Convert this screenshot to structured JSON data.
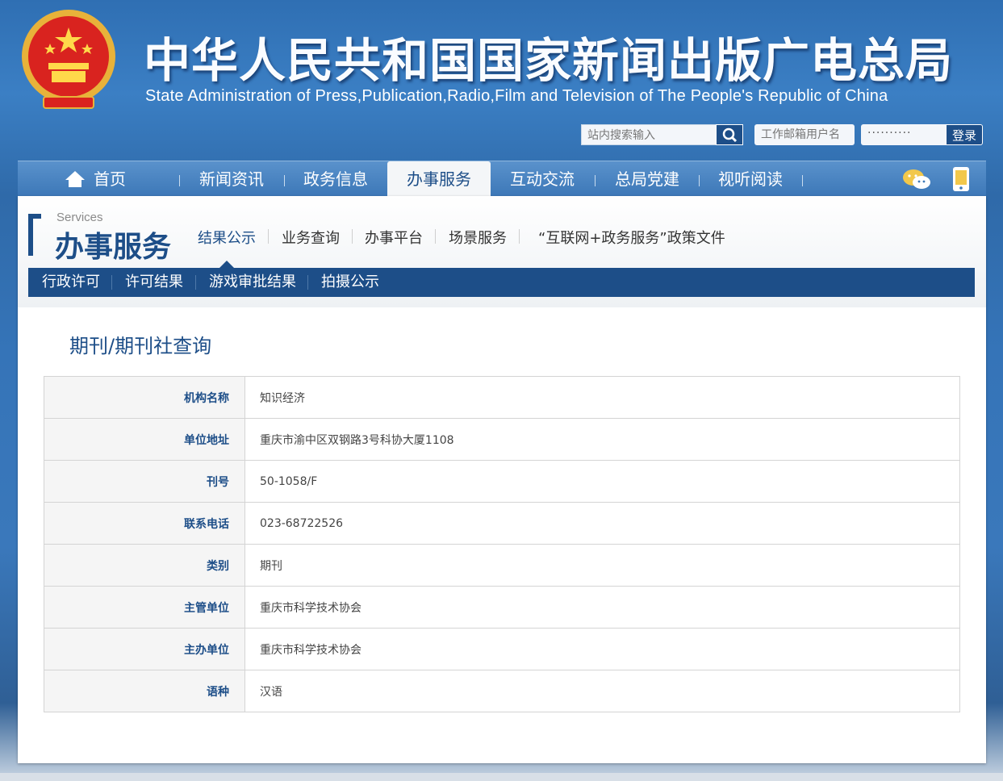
{
  "header": {
    "title_cn": "中华人民共和国国家新闻出版广电总局",
    "title_en": "State Administration of Press,Publication,Radio,Film and Television of The People's Republic of China",
    "search_placeholder": "站内搜索输入",
    "user_placeholder": "工作邮箱用户名",
    "password_mask": "··········",
    "login_label": "登录"
  },
  "nav": {
    "items": [
      {
        "label": "首页"
      },
      {
        "label": "新闻资讯"
      },
      {
        "label": "政务信息"
      },
      {
        "label": "办事服务"
      },
      {
        "label": "互动交流"
      },
      {
        "label": "总局党建"
      },
      {
        "label": "视听阅读"
      }
    ],
    "active": "办事服务"
  },
  "section": {
    "title_en": "Services",
    "title_cn": "办事服务",
    "subnav": [
      {
        "label": "结果公示"
      },
      {
        "label": "业务查询"
      },
      {
        "label": "办事平台"
      },
      {
        "label": "场景服务"
      },
      {
        "label": "“互联网+政务服务”政策文件"
      }
    ],
    "tabs": [
      {
        "label": "行政许可"
      },
      {
        "label": "许可结果"
      },
      {
        "label": "游戏审批结果"
      },
      {
        "label": "拍摄公示"
      }
    ]
  },
  "page": {
    "title": "期刊/期刊社查询",
    "rows": [
      {
        "key": "机构名称",
        "value": "知识经济"
      },
      {
        "key": "单位地址",
        "value": "重庆市渝中区双钢路3号科协大厦1108"
      },
      {
        "key": "刊号",
        "value": "50-1058/F"
      },
      {
        "key": "联系电话",
        "value": "023-68722526"
      },
      {
        "key": "类别",
        "value": "期刊"
      },
      {
        "key": "主管单位",
        "value": "重庆市科学技术协会"
      },
      {
        "key": "主办单位",
        "value": "重庆市科学技术协会"
      },
      {
        "key": "语种",
        "value": "汉语"
      }
    ]
  },
  "colors": {
    "brand_blue": "#1d4e88",
    "nav_blue": "#3c77b7"
  },
  "icons": [
    "national-emblem-icon",
    "search-icon",
    "home-icon",
    "wechat-icon",
    "mobile-icon"
  ]
}
